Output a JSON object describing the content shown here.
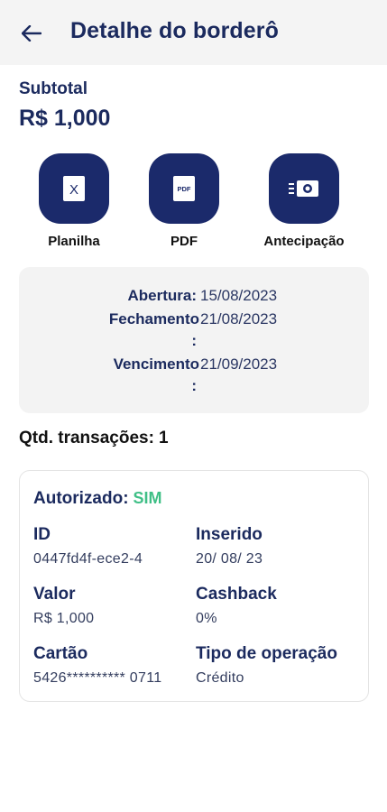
{
  "header": {
    "title": "Detalhe do borderô"
  },
  "subtotal": {
    "label": "Subtotal",
    "value": "R$ 1,000"
  },
  "actions": [
    {
      "label": "Planilha",
      "icon": "spreadsheet-x-icon",
      "glyph": "X"
    },
    {
      "label": "PDF",
      "icon": "pdf-icon",
      "glyph": "PDF"
    },
    {
      "label": "Antecipação",
      "icon": "cash-icon"
    }
  ],
  "dates": {
    "abertura_label": "Abertura:",
    "abertura_value": "15/08/2023",
    "fechamento_label": "Fechamento",
    "fechamento_colon": ":",
    "fechamento_value": "21/08/2023",
    "vencimento_label": "Vencimento",
    "vencimento_colon": ":",
    "vencimento_value": "21/09/2023"
  },
  "transactions": {
    "label": "Qtd. transações:",
    "count": "1"
  },
  "transaction": {
    "autorizado_label": "Autorizado:",
    "autorizado_value": "SIM",
    "id_label": "ID",
    "id_value": "0447fd4f-ece2-4",
    "inserido_label": "Inserido",
    "inserido_value": "20/ 08/ 23",
    "valor_label": "Valor",
    "valor_value": "R$ 1,000",
    "cashback_label": "Cashback",
    "cashback_value": "0%",
    "cartao_label": "Cartão",
    "cartao_value": "5426********** 0711",
    "tipo_label": "Tipo de operação",
    "tipo_value": "Crédito"
  },
  "colors": {
    "primary": "#1b2a6b",
    "text": "#1b2a5e",
    "success": "#3fbf86",
    "card_bg": "#f3f3f3"
  }
}
